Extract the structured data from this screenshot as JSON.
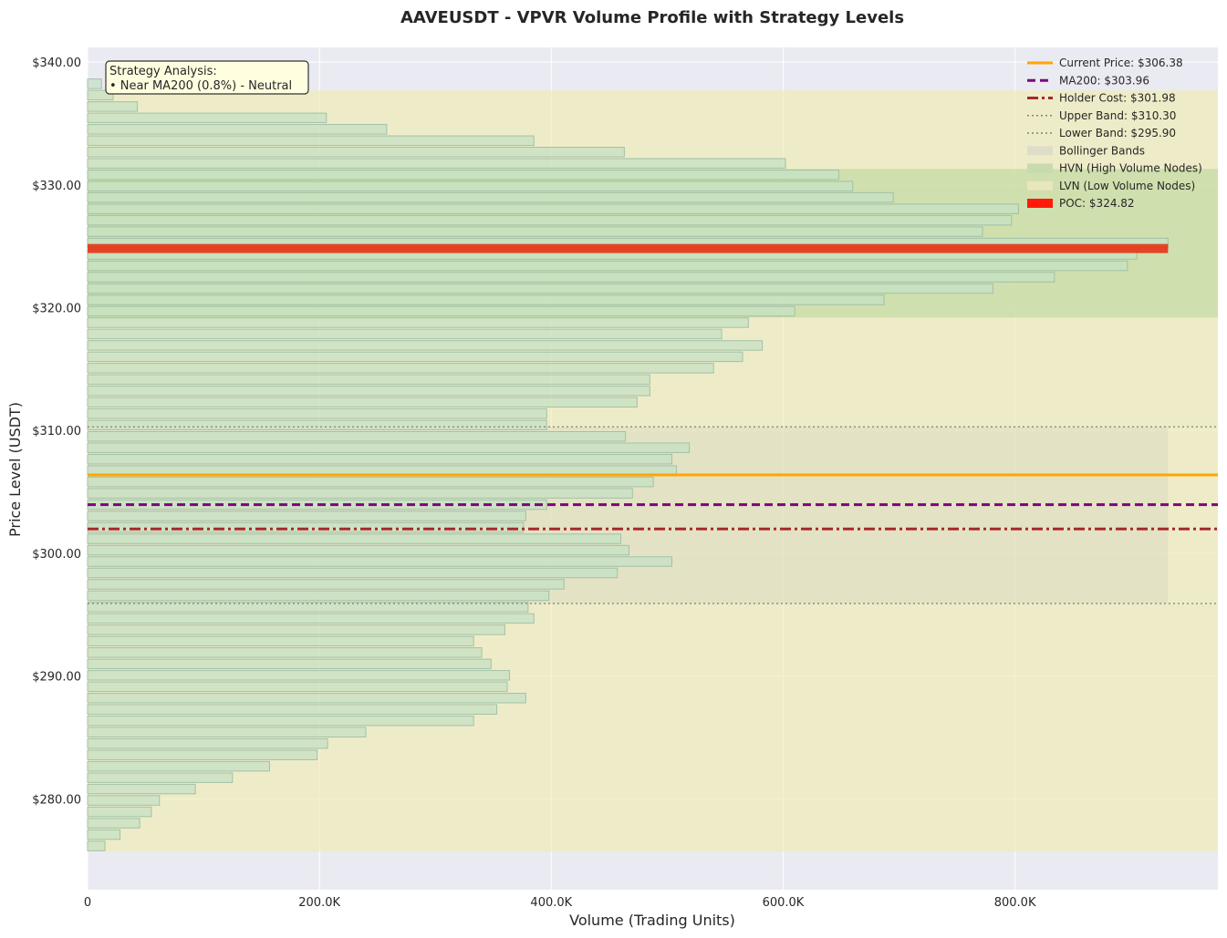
{
  "chart_data": {
    "type": "bar",
    "orientation": "horizontal",
    "title": "AAVEUSDT - VPVR Volume Profile with Strategy Levels",
    "xlabel": "Volume (Trading Units)",
    "ylabel": "Price Level (USDT)",
    "xlim": [
      0,
      975000
    ],
    "ylim": [
      272.6,
      341.2
    ],
    "x_ticks": [
      0,
      200000,
      400000,
      600000,
      800000
    ],
    "x_tick_labels": [
      "0",
      "200.0K",
      "400.0K",
      "600.0K",
      "800.0K"
    ],
    "y_ticks": [
      280,
      290,
      300,
      310,
      320,
      330,
      340
    ],
    "y_tick_labels": [
      "$280.00",
      "$290.00",
      "$300.00",
      "$310.00",
      "$320.00",
      "$330.00",
      "$340.00"
    ],
    "grid": true,
    "legend_position": "top-right",
    "bins": {
      "price_start": 275.7,
      "bin_height": 0.9265,
      "volumes": [
        15000,
        28000,
        45000,
        55000,
        62000,
        93000,
        125000,
        157000,
        198000,
        207000,
        240000,
        333000,
        353000,
        378000,
        362000,
        364000,
        348000,
        340000,
        333000,
        360000,
        385000,
        380000,
        398000,
        411000,
        457000,
        504000,
        467000,
        460000,
        376000,
        378000,
        396000,
        470000,
        488000,
        508000,
        504000,
        519000,
        464000,
        396000,
        396000,
        474000,
        485000,
        485000,
        540000,
        565000,
        582000,
        547000,
        570000,
        610000,
        687000,
        781000,
        834000,
        897000,
        905000,
        932000,
        772000,
        797000,
        803000,
        695000,
        660000,
        648000,
        602000,
        463000,
        385000,
        258000,
        206000,
        43000,
        22000,
        12000
      ]
    },
    "poc": {
      "price": 324.82,
      "volume": 932000,
      "label": "POC: $324.82",
      "color": "#e8290b"
    },
    "hvn_zone": [
      319.2,
      331.3
    ],
    "lvn_zone": [
      275.7,
      337.7
    ],
    "bollinger": {
      "upper": 310.3,
      "lower": 295.9,
      "width": 932000
    },
    "levels": [
      {
        "name": "Current Price",
        "value": 306.38,
        "label": "Current Price: $306.38",
        "color": "#ffa500",
        "style": "solid"
      },
      {
        "name": "MA200",
        "value": 303.96,
        "label": "MA200: $303.96",
        "color": "#800080",
        "style": "dashed"
      },
      {
        "name": "Holder Cost",
        "value": 301.98,
        "label": "Holder Cost: $301.98",
        "color": "#a52a2a",
        "style": "dashdot"
      },
      {
        "name": "Upper Band",
        "value": 310.3,
        "label": "Upper Band: $310.30",
        "color": "#808080",
        "style": "dotted"
      },
      {
        "name": "Lower Band",
        "value": 295.9,
        "label": "Lower Band: $295.90",
        "color": "#808080",
        "style": "dotted"
      }
    ],
    "legend": [
      {
        "label": "Current Price: $306.38",
        "kind": "line",
        "color": "#ffa500",
        "style": "solid"
      },
      {
        "label": "MA200: $303.96",
        "kind": "line",
        "color": "#800080",
        "style": "dashed"
      },
      {
        "label": "Holder Cost: $301.98",
        "kind": "line",
        "color": "#a52a2a",
        "style": "dashdot"
      },
      {
        "label": "Upper Band: $310.30",
        "kind": "line",
        "color": "#808080",
        "style": "dotted"
      },
      {
        "label": "Lower Band: $295.90",
        "kind": "line",
        "color": "#808080",
        "style": "dotted"
      },
      {
        "label": "Bollinger Bands",
        "kind": "patch",
        "color": "#dcdcc8"
      },
      {
        "label": "HVN (High Volume Nodes)",
        "kind": "patch",
        "color": "#c3d9ad"
      },
      {
        "label": "LVN (Low Volume Nodes)",
        "kind": "patch",
        "color": "#eae7bd"
      },
      {
        "label": "POC: $324.82",
        "kind": "patch",
        "color": "#ff1a0a"
      }
    ],
    "annotation": {
      "lines": [
        "Strategy Analysis:",
        "• Near MA200 (0.8%) - Neutral"
      ]
    },
    "colors": {
      "plot_bg": "#eaeaf2",
      "bar_fill": "#c6e2c4",
      "bar_edge": "#a3c0a6",
      "hvn_fill": "#a8d08c",
      "lvn_fill": "#f0ecb0",
      "boll_fill": "#d8d8c0",
      "annot_bg": "#ffffe0"
    }
  }
}
